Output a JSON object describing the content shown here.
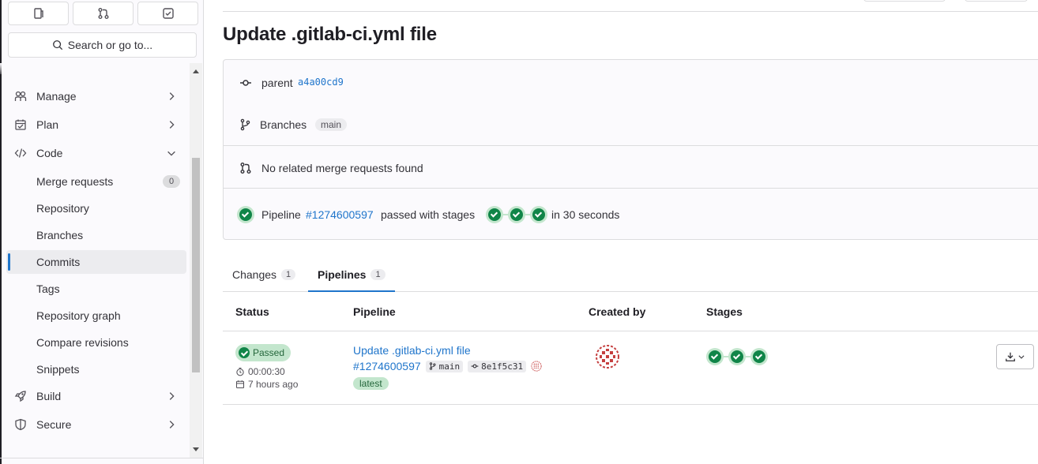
{
  "sidebar": {
    "top_buttons": [
      {
        "icon": "issues-icon"
      },
      {
        "icon": "merge-request-icon"
      },
      {
        "icon": "todo-icon"
      }
    ],
    "search_label": "Search or go to...",
    "items": [
      {
        "label": "Manage",
        "icon": "users-icon"
      },
      {
        "label": "Plan",
        "icon": "planning-icon"
      },
      {
        "label": "Code",
        "icon": "code-icon"
      },
      {
        "label": "Merge requests",
        "count": "0"
      },
      {
        "label": "Repository"
      },
      {
        "label": "Branches"
      },
      {
        "label": "Commits"
      },
      {
        "label": "Tags"
      },
      {
        "label": "Repository graph"
      },
      {
        "label": "Compare revisions"
      },
      {
        "label": "Snippets"
      },
      {
        "label": "Build",
        "icon": "rocket-icon"
      },
      {
        "label": "Secure",
        "icon": "shield-icon"
      }
    ]
  },
  "page": {
    "title": "Update .gitlab-ci.yml file",
    "parent_label": "parent",
    "parent_sha": "a4a00cd9",
    "branches_label": "Branches",
    "branch": "main",
    "merge_requests_text": "No related merge requests found",
    "pipeline": {
      "prefix": "Pipeline",
      "id": "#1274600597",
      "passed_text": "passed with stages",
      "duration_text": "in 30 seconds"
    }
  },
  "tabs": [
    {
      "label": "Changes",
      "count": "1"
    },
    {
      "label": "Pipelines",
      "count": "1"
    }
  ],
  "table": {
    "headers": [
      "Status",
      "Pipeline",
      "Created by",
      "Stages"
    ],
    "row": {
      "status": "Passed",
      "duration": "00:00:30",
      "finished": "7 hours ago",
      "commit_title": "Update .gitlab-ci.yml file",
      "pipeline_id": "#1274600597",
      "ref": "main",
      "sha": "8e1f5c31",
      "tag": "latest"
    }
  },
  "colors": {
    "accent": "#1f75cb",
    "success": "#108548",
    "success_bg": "#c3e6cd"
  }
}
